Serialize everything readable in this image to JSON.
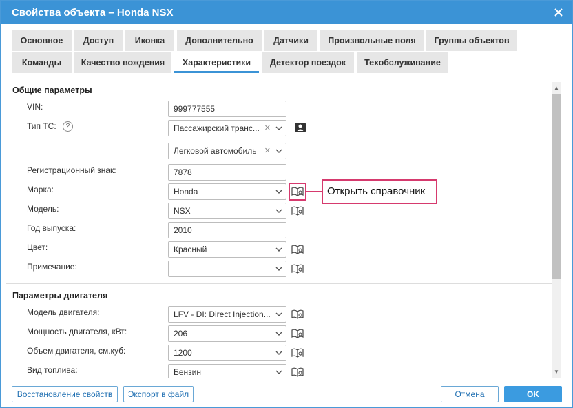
{
  "window": {
    "title": "Свойства объекта – Honda NSX"
  },
  "tabs": [
    "Основное",
    "Доступ",
    "Иконка",
    "Дополнительно",
    "Датчики",
    "Произвольные поля",
    "Группы объектов",
    "Команды",
    "Качество вождения",
    "Характеристики",
    "Детектор поездок",
    "Техобслуживание"
  ],
  "active_tab": "Характеристики",
  "general": {
    "title": "Общие параметры",
    "vin_label": "VIN:",
    "vin_value": "999777555",
    "type_label": "Тип ТС:",
    "type_value_1": "Пассажирский транс...",
    "type_value_2": "Легковой автомобиль",
    "plate_label": "Регистрационный знак:",
    "plate_value": "7878",
    "make_label": "Марка:",
    "make_value": "Honda",
    "model_label": "Модель:",
    "model_value": "NSX",
    "year_label": "Год выпуска:",
    "year_value": "2010",
    "color_label": "Цвет:",
    "color_value": "Красный",
    "note_label": "Примечание:",
    "note_value": ""
  },
  "engine": {
    "title": "Параметры двигателя",
    "model_label": "Модель двигателя:",
    "model_value": "LFV - DI: Direct Injection...",
    "power_label": "Мощность двигателя, кВт:",
    "power_value": "206",
    "volume_label": "Объем двигателя, см.куб:",
    "volume_value": "1200",
    "fuel_label": "Вид топлива:",
    "fuel_value": "Бензин"
  },
  "callout": {
    "text": "Открыть справочник"
  },
  "buttons": {
    "restore": "Восстановление свойств",
    "export": "Экспорт в файл",
    "cancel": "Отмена",
    "ok": "OK"
  },
  "colors": {
    "accent": "#3b93d6",
    "highlight": "#d63a6e",
    "tab_bg": "#e6e6e6"
  }
}
